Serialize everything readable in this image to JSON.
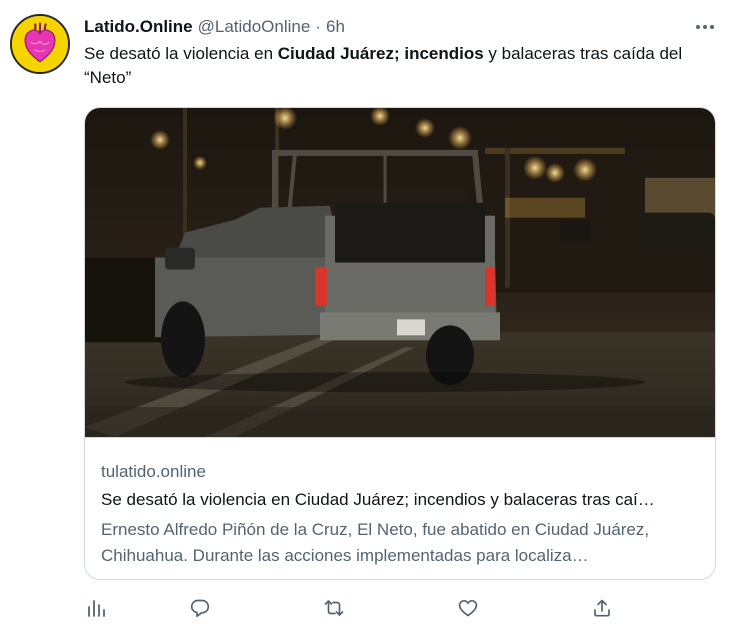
{
  "author": {
    "name": "Latido.Online",
    "handle": "@LatidoOnline",
    "separator": "·",
    "time": "6h"
  },
  "tweet": {
    "text_parts": [
      "Se desató la violencia en ",
      "Ciudad Juárez",
      "; ",
      "incendios",
      " y balaceras tras caída del “Neto”"
    ]
  },
  "card": {
    "domain": "tulatido.online",
    "title": "Se desató la violencia en Ciudad Juárez; incendios y balaceras tras caí…",
    "description": "Ernesto Alfredo Piñón de la Cruz, El Neto, fue abatido en Ciudad Juárez, Chihuahua. Durante las acciones implementadas para localiza…"
  },
  "actions": [
    {
      "name": "analytics",
      "icon": "bar-chart-icon"
    },
    {
      "name": "reply",
      "icon": "speech-bubble-icon"
    },
    {
      "name": "retweet",
      "icon": "retweet-arrows-icon"
    },
    {
      "name": "like",
      "icon": "heart-outline-icon"
    },
    {
      "name": "share",
      "icon": "share-upload-icon"
    }
  ],
  "colors": {
    "text_primary": "#0f1419",
    "text_secondary": "#536471",
    "border": "#cfd9de",
    "avatar_bg": "#f5d400",
    "heart_magenta": "#e636b4"
  }
}
